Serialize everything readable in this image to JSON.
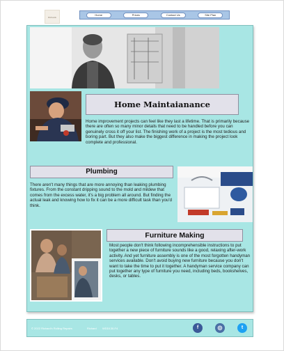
{
  "header": {
    "logo_text": "Richards"
  },
  "nav": {
    "items": [
      {
        "label": "Home"
      },
      {
        "label": "Prices"
      },
      {
        "label": "Contact Us"
      },
      {
        "label": "Site Plan"
      }
    ]
  },
  "sections": [
    {
      "title": "Home Maintaianance",
      "body": "Home improvement projects can feel like they last a lifetime. That is primarily because there are often so many minor details that need to be handled before you can genuinely cross it off your list. The finishing work of a project is the most tedious and boring part. But they also make the biggest difference in making the project look complete and professional."
    },
    {
      "title": "Plumbing",
      "body": "There aren't many things that are more annoying than leaking plumbing fixtures. From the constant dripping sound to the mold and mildew that comes from the excess water, it's a big problem all around. But finding the actual leak and knowing how to fix it can be a more difficult task than you'd think."
    },
    {
      "title": "Furniture Making",
      "body": "Most people don't think following incomprehensible instructions to put together a new piece of furniture sounds like a good, relaxing after-work activity. And yet furniture assembly is one of the most forgotten handyman services available. Don't avoid buying new furniture because you don't want to take the time to put it together. A handyman service company can put together any type of furniture you need, including beds, bookshelves, desks, or tables."
    }
  ],
  "footer": {
    "copyright": "© 2022 Richard's Rolling Repairs",
    "author": "Richard",
    "course": "WDD130-F4",
    "social": [
      {
        "icon": "facebook-icon",
        "glyph": "f",
        "color": "#3b5998"
      },
      {
        "icon": "instagram-icon",
        "glyph": "◎",
        "color": "#4a6fa5"
      },
      {
        "icon": "twitter-icon",
        "glyph": "t",
        "color": "#1da1f2"
      }
    ]
  }
}
